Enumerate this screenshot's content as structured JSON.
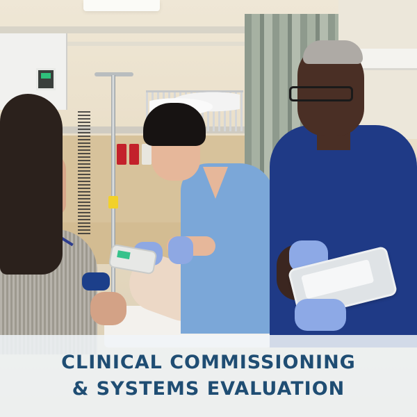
{
  "banner": {
    "title_line1": "CLINICAL COMMISSIONING",
    "title_line2": "& SYSTEMS EVALUATION",
    "title_color": "#1f4d73"
  },
  "photo": {
    "subject": "hospital-room-clinical-staff-photo"
  }
}
